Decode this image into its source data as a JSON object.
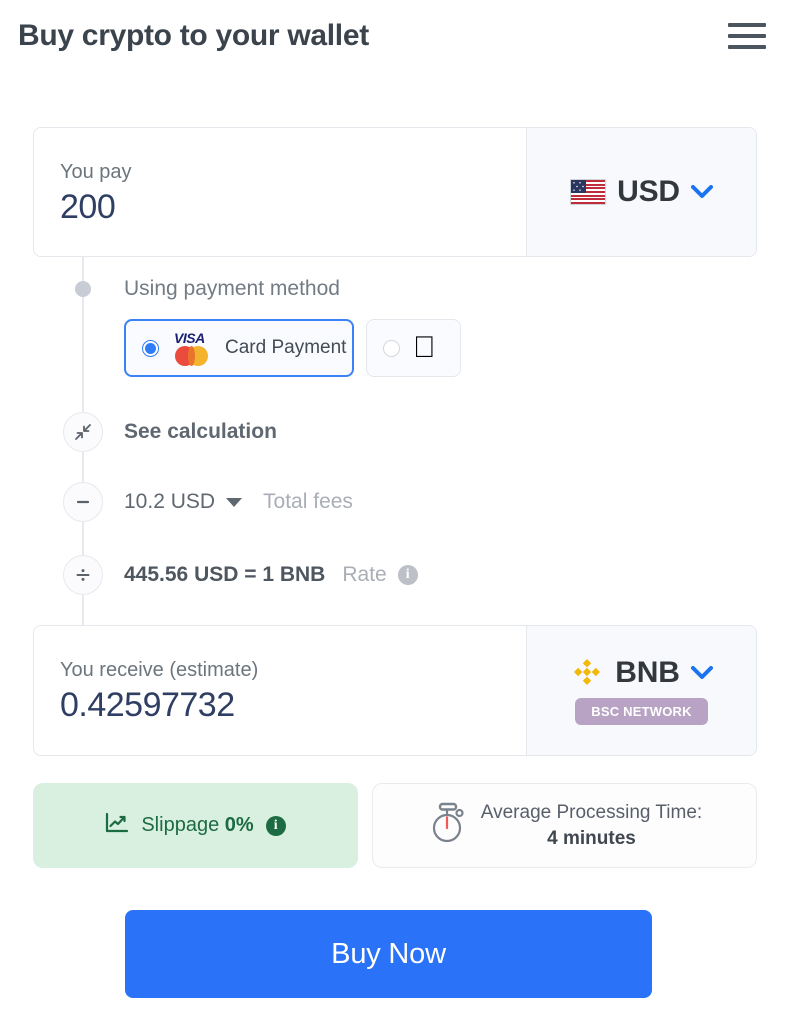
{
  "header": {
    "title": "Buy crypto to your wallet",
    "menu_icon": "hamburger-menu-icon"
  },
  "pay": {
    "label": "You pay",
    "amount": "200",
    "currency": "USD",
    "currency_icon": "us-flag-icon",
    "chevron_icon": "chevron-down-icon"
  },
  "payment_method": {
    "label": "Using payment method",
    "options": [
      {
        "id": "card",
        "label": "Card Payment",
        "icon": "visa-mastercard-icon",
        "selected": true
      },
      {
        "id": "apple",
        "label": "",
        "icon": "apple-pay-icon",
        "selected": false
      }
    ]
  },
  "calculation": {
    "see_calculation": "See calculation",
    "see_calculation_icon": "collapse-arrows-icon",
    "fees_icon": "minus-icon",
    "fees_amount": "10.2 USD",
    "fees_caret_icon": "caret-down-icon",
    "fees_label": "Total fees",
    "rate_icon": "divide-icon",
    "rate_value": "445.56 USD = 1 BNB",
    "rate_label": "Rate",
    "rate_info_icon": "info-icon"
  },
  "receive": {
    "label": "You receive (estimate)",
    "amount": "0.42597732",
    "currency": "BNB",
    "currency_icon": "bnb-logo-icon",
    "chevron_icon": "chevron-down-icon",
    "network_badge": "BSC NETWORK"
  },
  "tiles": {
    "slippage": {
      "chart_icon": "line-chart-icon",
      "text": "Slippage",
      "value": "0%",
      "info_icon": "info-icon"
    },
    "processing_time": {
      "stopwatch_icon": "stopwatch-icon",
      "label": "Average Processing Time:",
      "value": "4 minutes"
    }
  },
  "action": {
    "buy_label": "Buy Now"
  },
  "colors": {
    "accent_blue": "#2a72f8",
    "amount_navy": "#2f3f63",
    "slippage_green_bg": "#d9f0e1",
    "slippage_green_text": "#1d6b42",
    "network_badge_bg": "#b8a3c4"
  }
}
